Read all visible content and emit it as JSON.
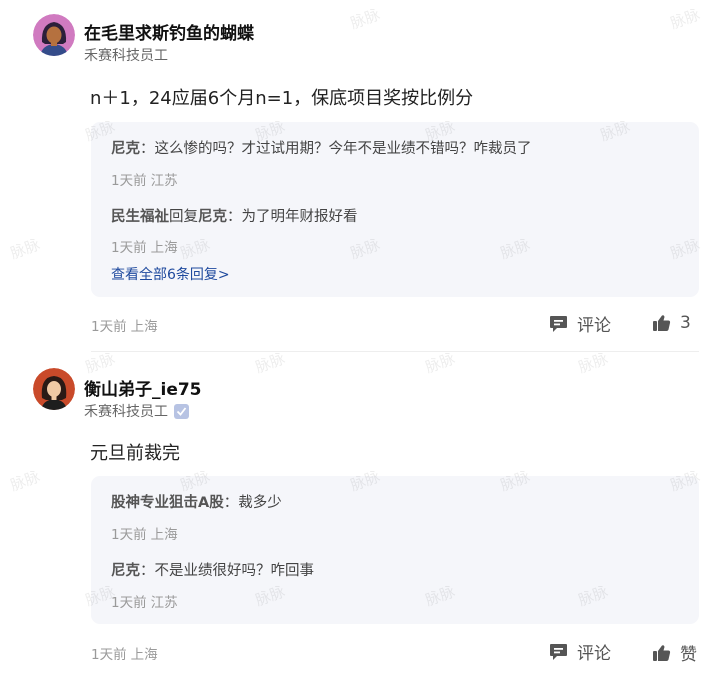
{
  "watermark_text": "脉脉",
  "posts": [
    {
      "author": "在毛里求斯钓鱼的蝴蝶",
      "company": "禾赛科技员工",
      "verified": false,
      "content": "n＋1，24应届6个月n=1，保底项目奖按比例分",
      "replies": [
        {
          "nick": "尼克",
          "connector": "",
          "target": "",
          "sep": "：",
          "text": "这么惨的吗？才过试用期？今年不是业绩不错吗？咋裁员了",
          "time": "1天前",
          "location": "江苏"
        },
        {
          "nick": "民生福祉",
          "connector": "回复",
          "target": "尼克",
          "sep": "：",
          "text": "为了明年财报好看",
          "time": "1天前",
          "location": "上海"
        }
      ],
      "view_all": "查看全部6条回复>",
      "time": "1天前",
      "location": "上海",
      "comment_label": "评论",
      "like_label": "3"
    },
    {
      "author": "衡山弟子_ie75",
      "company": "禾赛科技员工",
      "verified": true,
      "content": "元旦前裁完",
      "replies": [
        {
          "nick": "股神专业狙击A股",
          "connector": "",
          "target": "",
          "sep": "：",
          "text": "裁多少",
          "time": "1天前",
          "location": "上海"
        },
        {
          "nick": "尼克",
          "connector": "",
          "target": "",
          "sep": "：",
          "text": "不是业绩很好吗？咋回事",
          "time": "1天前",
          "location": "江苏"
        }
      ],
      "time": "1天前",
      "location": "上海",
      "comment_label": "评论",
      "like_label": "赞"
    }
  ],
  "colors": {
    "reply_bg": "#f5f6fa",
    "link": "#1f4a9e",
    "verified_badge": "#b7c3e3"
  },
  "icons": {
    "comment": "comment-bubble-icon",
    "like": "thumbs-up-icon",
    "verified": "verified-badge-icon"
  }
}
